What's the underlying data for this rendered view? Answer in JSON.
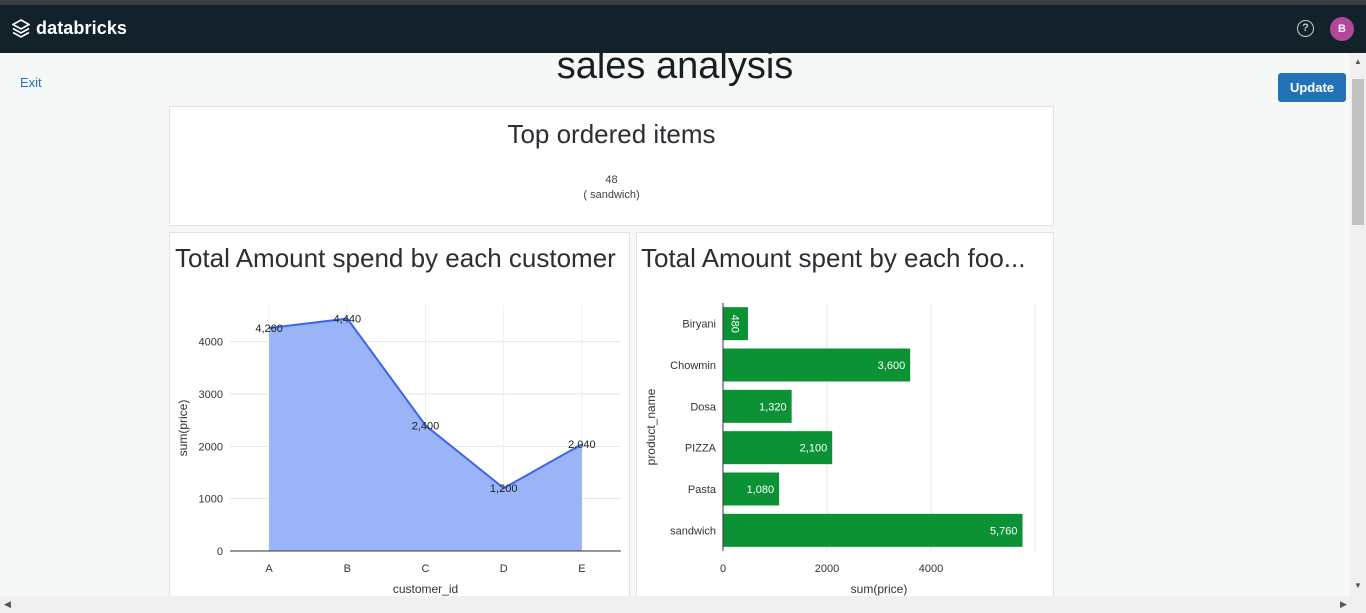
{
  "header": {
    "brand": "databricks",
    "help_icon": "?",
    "avatar_initial": "B"
  },
  "nav": {
    "exit_label": "Exit",
    "update_label": "Update"
  },
  "page_title": "sales analysis",
  "counter_card": {
    "title": "Top ordered items",
    "value": "48",
    "label": "( sandwich)"
  },
  "area_card": {
    "title": "Total Amount spend by each customer"
  },
  "bar_card": {
    "title": "Total Amount spent by each foo..."
  },
  "colors": {
    "topbar": "#12212a",
    "area_fill": "#9bb3f7",
    "area_line": "#3a66ef",
    "bar": "#0b9235",
    "update": "#2372b8",
    "avatar": "#b3489a"
  },
  "chart_data": [
    {
      "type": "area",
      "categories": [
        "A",
        "B",
        "C",
        "D",
        "E"
      ],
      "values": [
        4260,
        4440,
        2400,
        1200,
        2040
      ],
      "data_labels": [
        "4,260",
        "4,440",
        "2,400",
        "1,200",
        "2,040"
      ],
      "xlabel": "customer_id",
      "ylabel": "sum(price)",
      "yticks": [
        "0",
        "1000",
        "2000",
        "3000",
        "4000"
      ],
      "ylim": [
        0,
        4700
      ],
      "grid": true
    },
    {
      "type": "bar",
      "orientation": "horizontal",
      "categories": [
        "Biryani",
        "Chowmin",
        "Dosa",
        "PIZZA",
        "Pasta",
        "sandwich"
      ],
      "values": [
        480,
        3600,
        1320,
        2100,
        1080,
        5760
      ],
      "data_labels": [
        "480",
        "3,600",
        "1,320",
        "2,100",
        "1,080",
        "5,760"
      ],
      "xlabel": "sum(price)",
      "ylabel": "product_name",
      "xticks": [
        "0",
        "2000",
        "4000"
      ],
      "xlim": [
        0,
        6000
      ],
      "grid": true
    }
  ]
}
